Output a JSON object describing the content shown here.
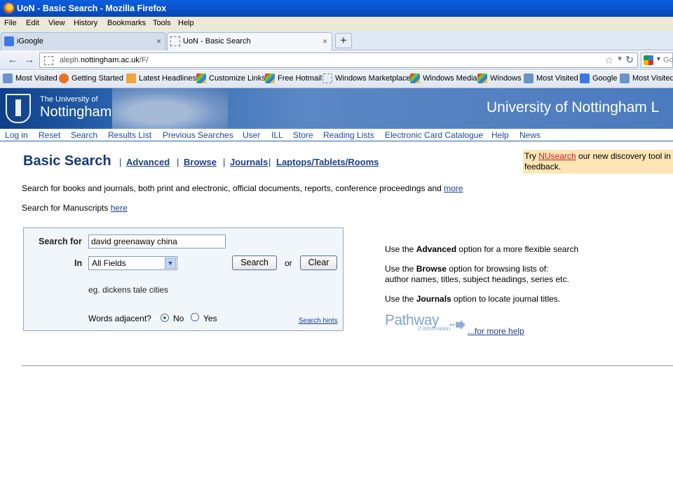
{
  "window": {
    "title": "UoN - Basic Search - Mozilla Firefox"
  },
  "menu": [
    "File",
    "Edit",
    "View",
    "History",
    "Bookmarks",
    "Tools",
    "Help"
  ],
  "tabs": [
    {
      "label": "iGoogle",
      "active": false
    },
    {
      "label": "UoN - Basic Search",
      "active": true
    }
  ],
  "new_tab_label": "+",
  "close_glyph": "×",
  "url": {
    "prefix": "aleph.",
    "site": "nottingham.ac.uk",
    "path": "/F/"
  },
  "browser_search": {
    "placeholder": "Go"
  },
  "bookmarks": [
    {
      "label": "Most Visited",
      "icon": "page-icon"
    },
    {
      "label": "Getting Started",
      "icon": "firefox-icon"
    },
    {
      "label": "Latest Headlines",
      "icon": "rss-icon"
    },
    {
      "label": "Customize Links",
      "icon": "windows-icon"
    },
    {
      "label": "Free Hotmail",
      "icon": "windows-icon"
    },
    {
      "label": "Windows Marketplace",
      "icon": "blank-page-icon"
    },
    {
      "label": "Windows Media",
      "icon": "windows-icon"
    },
    {
      "label": "Windows",
      "icon": "windows-icon"
    },
    {
      "label": "Most Visited",
      "icon": "page-icon"
    },
    {
      "label": "Google",
      "icon": "google-icon"
    },
    {
      "label": "Most Visited",
      "icon": "page-icon"
    }
  ],
  "site": {
    "logo_small": "The University of",
    "logo_big": "Nottingham",
    "title": "University of Nottingham L"
  },
  "site_nav": [
    "Log in",
    "Reset",
    "Search",
    "Results List",
    "Previous Searches",
    "User",
    "ILL",
    "Store",
    "Reading Lists",
    "Electronic Card Catalogue",
    "Help",
    "News"
  ],
  "page": {
    "heading": "Basic Search",
    "sublinks": [
      "Advanced",
      "Browse",
      "Journals",
      "Laptops/Tablets/Rooms"
    ],
    "banner": {
      "pre": "Try ",
      "link": "NUsearch",
      "post": " our new discovery tool in",
      "line2": "feedback."
    },
    "intro": "Search for books and journals, both print and electronic, official documents, reports, conference proceedings and ",
    "intro_link": "more",
    "manuscripts": "Search for Manuscripts ",
    "manuscripts_link": "here"
  },
  "form": {
    "search_label": "Search for",
    "search_value": "david greenaway china",
    "in_label": "In",
    "field_value": "All Fields",
    "search_button": "Search",
    "or_text": "or",
    "clear_button": "Clear",
    "example": "eg. dickens tale cities",
    "adjacent_label": "Words adjacent?",
    "adjacent_options": [
      {
        "label": "No",
        "checked": true
      },
      {
        "label": "Yes",
        "checked": false
      }
    ],
    "hints_link": "Search hints"
  },
  "help": {
    "advanced": {
      "pre": "Use the ",
      "bold": "Advanced",
      "post": " option for a more flexible search"
    },
    "browse": {
      "pre": "Use the ",
      "bold": "Browse",
      "post": " option for browsing lists of:",
      "line2": "author names, titles, subject headings, series etc."
    },
    "journals": {
      "pre": "Use the ",
      "bold": "Journals",
      "post": " option to locate journal titles."
    },
    "pathway": {
      "word": "Pathway",
      "sub": "2 information"
    },
    "more_help": "...for more help"
  },
  "colors": {
    "titlebar": "#0a5fe0",
    "header_blue": "#2f6ab3",
    "link_blue": "#1a3f8a",
    "banner_bg": "#fde5b5",
    "nusearch_red": "#c81e1e"
  }
}
